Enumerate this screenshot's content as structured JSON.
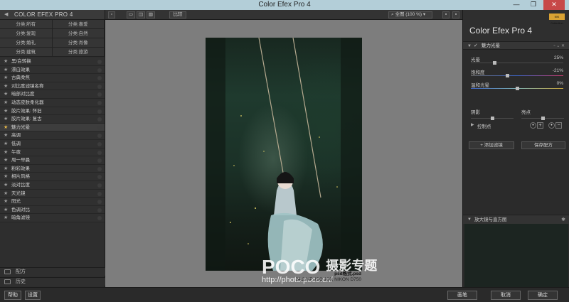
{
  "window": {
    "title": "Color Efex Pro 4",
    "minimize": "—",
    "maximize": "❐",
    "close": "✕"
  },
  "left_panel": {
    "header": "COLOR EFEX PRO 4",
    "categories": [
      "分类:所有",
      "分类:喜爱",
      "分类:复现",
      "分类:自然",
      "分类:婚礼",
      "分类:肖像",
      "分类:建筑",
      "分类:旅游"
    ],
    "filters": [
      {
        "name": "黑/白转换",
        "favorite": false
      },
      {
        "name": "漂白效果",
        "favorite": false
      },
      {
        "name": "古典柔焦",
        "favorite": false
      },
      {
        "name": "对比度滤镜名称",
        "favorite": false
      },
      {
        "name": "暗部对比度",
        "favorite": false
      },
      {
        "name": "动态皮肤柔化器",
        "favorite": false
      },
      {
        "name": "胶片效果: 怀旧",
        "favorite": false
      },
      {
        "name": "胶片效果: 复古",
        "favorite": false
      },
      {
        "name": "魅力光晕",
        "favorite": true
      },
      {
        "name": "高调",
        "favorite": false
      },
      {
        "name": "低调",
        "favorite": false
      },
      {
        "name": "午夜",
        "favorite": false
      },
      {
        "name": "周一早晨",
        "favorite": false
      },
      {
        "name": "粉彩效果",
        "favorite": false
      },
      {
        "name": "相片风格",
        "favorite": false
      },
      {
        "name": "淡对比度",
        "favorite": false
      },
      {
        "name": "天光镜",
        "favorite": false
      },
      {
        "name": "阳光",
        "favorite": false
      },
      {
        "name": "色调对比",
        "favorite": false
      },
      {
        "name": "暗角滤镜",
        "favorite": false
      }
    ],
    "recipes_label": "配方",
    "history_label": "历史"
  },
  "toolbar": {
    "compare_label": "比较",
    "zoom_label": "全图 (100 %)"
  },
  "photo": {
    "filename": "psd格式.psd",
    "info": "24.2 MP, ISO 100, NIKON D750"
  },
  "watermark": {
    "brand": "POCO",
    "sub": "摄影专题",
    "url": "http://photo.poco.cn/"
  },
  "right_panel": {
    "brand_title": "Color Efex Pro 4",
    "brand_badge": "NIK Collection",
    "filter_section": "魅力光晕",
    "sliders": [
      {
        "label": "光晕",
        "value": "25%",
        "level": 0.25,
        "gradient": false
      },
      {
        "label": "饱和度",
        "value": "-21%",
        "level": 0.39,
        "gradient": true
      },
      {
        "label": "温和光晕",
        "value": "0%",
        "level": 0.5,
        "gradient": true
      }
    ],
    "shadows_label": "阴影",
    "shadows_level": 0.5,
    "highlights_label": "亮点",
    "highlights_level": 0.5,
    "control_points_label": "控制点",
    "add_filter_label": "添加滤镜",
    "save_recipe_label": "保存配方",
    "loupe_label": "放大镜与直方图"
  },
  "bottom_bar": {
    "help": "帮助",
    "settings": "设置",
    "brush": "画笔",
    "cancel": "取消",
    "ok": "确定"
  }
}
